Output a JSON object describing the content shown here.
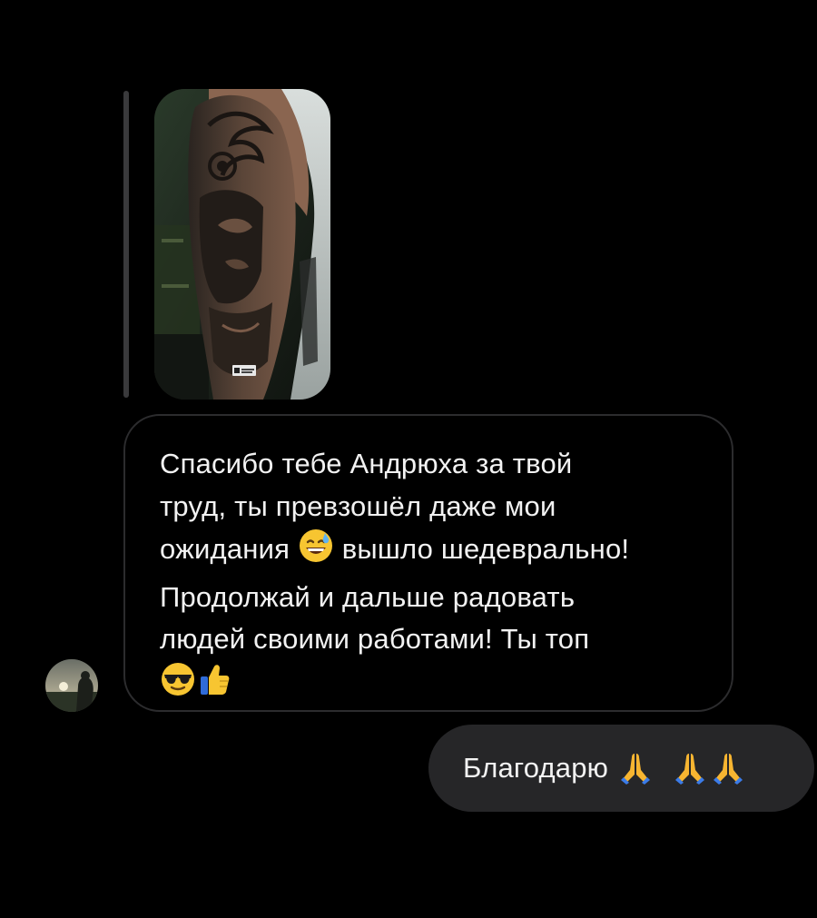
{
  "chat": {
    "incoming_message": {
      "lines": [
        "Спасибо тебе Андрюха за твой",
        "труд, ты превзошёл даже мои",
        "ожидания",
        "вышло шедеврально!",
        "Продолжай и дальше радовать",
        "людей своими работами! Ты топ"
      ],
      "emojis": [
        "grinning-sweat-emoji",
        "sunglasses-emoji",
        "thumbs-up-emoji"
      ]
    },
    "outgoing_message": {
      "text": "Благодарю",
      "emojis": [
        "folded-hands-emoji",
        "folded-hands-emoji",
        "folded-hands-emoji"
      ]
    },
    "shared_photo": {
      "icon": "tattoo-sleeve-photo"
    },
    "avatar": {
      "icon": "user-avatar-photo"
    },
    "colors": {
      "background": "#000000",
      "incoming_border": "#2c2c2e",
      "outgoing_bubble": "#262628",
      "reply_bar": "#3a3a3c",
      "text": "#f2f2f2"
    }
  }
}
